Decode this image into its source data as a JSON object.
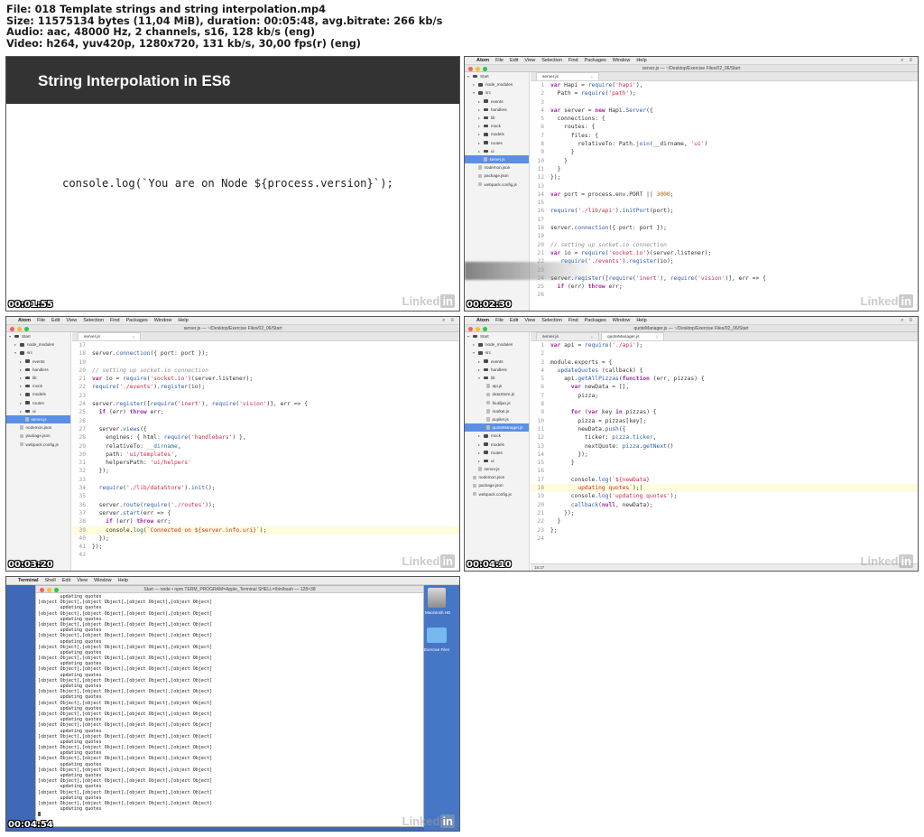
{
  "header": {
    "line1": "File: 018 Template strings and string interpolation.mp4",
    "line2": "Size: 11575134 bytes (11,04 MiB), duration: 00:05:48, avg.bitrate: 266 kb/s",
    "line3": "Audio: aac, 48000 Hz, 2 channels, s16, 128 kb/s (eng)",
    "line4": "Video: h264, yuv420p, 1280x720, 131 kb/s, 30,00 fps(r) (eng)"
  },
  "watermark": {
    "text": "Linked",
    "badge": "in"
  },
  "frames": {
    "slide": {
      "timestamp": "00:01:55",
      "title": "String Interpolation in ES6",
      "code": "console.log(`You are on Node ${process.version}`);"
    },
    "atom1": {
      "timestamp": "00:02:30",
      "menu": [
        "Atom",
        "File",
        "Edit",
        "View",
        "Selection",
        "Find",
        "Packages",
        "Window",
        "Help"
      ],
      "window_title": "server.js — ~/Desktop/Exercise Files/02_06/Start",
      "tab": "server.js",
      "tab_close": "×",
      "tree": [
        "Start",
        "node_modules",
        "src",
        "events",
        "handlers",
        "lib",
        "mock",
        "models",
        "routes",
        "ui",
        "server.js",
        "nodemon.json",
        "package.json",
        "webpack.config.js"
      ],
      "status": "LF  UTF-8  JavaScript"
    },
    "atom2": {
      "timestamp": "00:03:20",
      "menu": [
        "Atom",
        "File",
        "Edit",
        "View",
        "Selection",
        "Find",
        "Packages",
        "Window",
        "Help"
      ],
      "window_title": "server.js — ~/Desktop/Exercise Files/02_06/Start",
      "tab": "server.js",
      "tab_close": "×",
      "tree": [
        "Start",
        "node_modules",
        "src",
        "events",
        "handlers",
        "lib",
        "mock",
        "models",
        "routes",
        "ui",
        "server.js",
        "nodemon.json",
        "package.json",
        "webpack.config.js"
      ]
    },
    "atom3": {
      "timestamp": "00:04:10",
      "menu": [
        "Atom",
        "File",
        "Edit",
        "View",
        "Selection",
        "Find",
        "Packages",
        "Window",
        "Help"
      ],
      "window_title": "quoteManager.js — ~/Desktop/Exercise Files/02_06/Start",
      "tabs": [
        "server.js",
        "quoteManager.js"
      ],
      "tab_close": "×",
      "tree": [
        "Start",
        "node_modules",
        "src",
        "events",
        "handlers",
        "lib",
        "api.js",
        "dataStore.js",
        "fsutiljan.js",
        "market.js",
        "pupiler.js",
        "quoteManager.js",
        "mock",
        "models",
        "routes",
        "ui",
        "server.js",
        "nodemon.json",
        "package.json",
        "webpack.config.js"
      ],
      "status": "18:37"
    },
    "terminal": {
      "timestamp": "00:04:54",
      "menu": [
        "Terminal",
        "Shell",
        "Edit",
        "View",
        "Window",
        "Help"
      ],
      "window_title": "Start — node • npm TERM_PROGRAM=Apple_Terminal SHELL=/bin/bash — 128×38",
      "desktop_drive_label": "Macintosh HD",
      "desktop_folder_label": "Exercise Files",
      "line_updating": "        updating quotes",
      "line_objects": "[object Object],[object Object],[object Object],[object Object]"
    }
  },
  "colors": {
    "slide_bar": "#333333",
    "selection": "#5b8fe5",
    "line_highlight": "#fffbdd",
    "desktop": "#3f68b8"
  }
}
